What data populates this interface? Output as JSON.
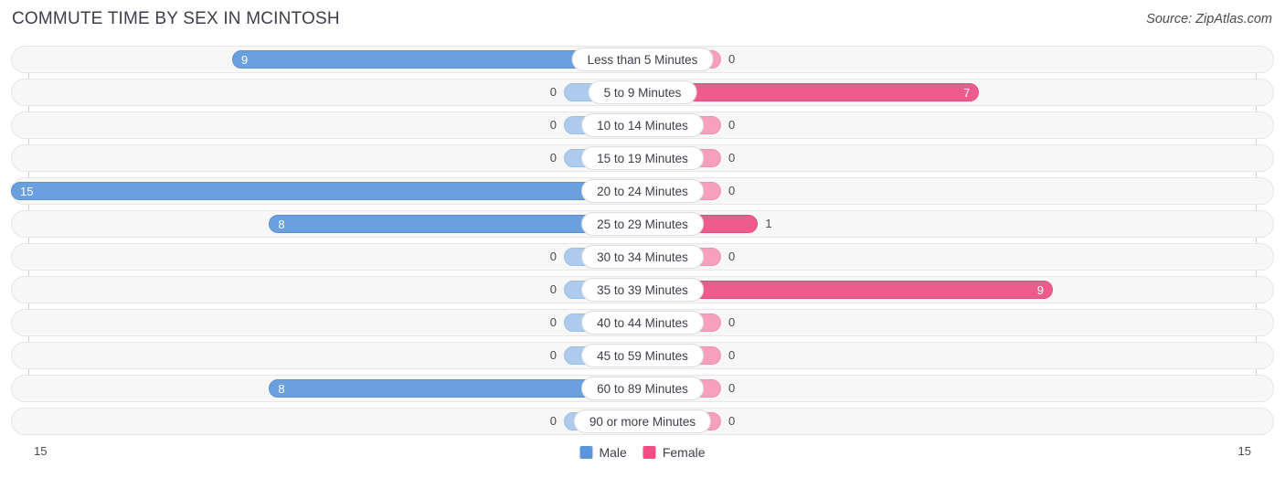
{
  "header": {
    "title": "COMMUTE TIME BY SEX IN MCINTOSH",
    "source": "Source: ZipAtlas.com"
  },
  "legend": {
    "male_label": "Male",
    "female_label": "Female",
    "male_color": "#5b95dd",
    "female_color": "#ef4f84"
  },
  "axis": {
    "left_label": "15",
    "right_label": "15",
    "max": 15
  },
  "chart_data": {
    "type": "bar",
    "title": "COMMUTE TIME BY SEX IN MCINTOSH",
    "subtitle": "Source: ZipAtlas.com",
    "orientation": "horizontal-diverging",
    "xlabel": "",
    "ylabel": "",
    "xlim": [
      15,
      15
    ],
    "grid": false,
    "legend_position": "bottom-center",
    "categories": [
      "Less than 5 Minutes",
      "5 to 9 Minutes",
      "10 to 14 Minutes",
      "15 to 19 Minutes",
      "20 to 24 Minutes",
      "25 to 29 Minutes",
      "30 to 34 Minutes",
      "35 to 39 Minutes",
      "40 to 44 Minutes",
      "45 to 59 Minutes",
      "60 to 89 Minutes",
      "90 or more Minutes"
    ],
    "series": [
      {
        "name": "Male",
        "color": "#5b95dd",
        "values": [
          9,
          0,
          0,
          0,
          15,
          8,
          0,
          0,
          0,
          0,
          8,
          0
        ]
      },
      {
        "name": "Female",
        "color": "#ef4f84",
        "values": [
          0,
          7,
          0,
          0,
          0,
          1,
          0,
          9,
          0,
          0,
          0,
          0
        ]
      }
    ]
  },
  "rows": [
    {
      "label": "Less than 5 Minutes",
      "male": 9,
      "male_text": "9",
      "female": 0,
      "female_text": "0"
    },
    {
      "label": "5 to 9 Minutes",
      "male": 0,
      "male_text": "0",
      "female": 7,
      "female_text": "7"
    },
    {
      "label": "10 to 14 Minutes",
      "male": 0,
      "male_text": "0",
      "female": 0,
      "female_text": "0"
    },
    {
      "label": "15 to 19 Minutes",
      "male": 0,
      "male_text": "0",
      "female": 0,
      "female_text": "0"
    },
    {
      "label": "20 to 24 Minutes",
      "male": 15,
      "male_text": "15",
      "female": 0,
      "female_text": "0"
    },
    {
      "label": "25 to 29 Minutes",
      "male": 8,
      "male_text": "8",
      "female": 1,
      "female_text": "1"
    },
    {
      "label": "30 to 34 Minutes",
      "male": 0,
      "male_text": "0",
      "female": 0,
      "female_text": "0"
    },
    {
      "label": "35 to 39 Minutes",
      "male": 0,
      "male_text": "0",
      "female": 9,
      "female_text": "9"
    },
    {
      "label": "40 to 44 Minutes",
      "male": 0,
      "male_text": "0",
      "female": 0,
      "female_text": "0"
    },
    {
      "label": "45 to 59 Minutes",
      "male": 0,
      "male_text": "0",
      "female": 0,
      "female_text": "0"
    },
    {
      "label": "60 to 89 Minutes",
      "male": 8,
      "male_text": "8",
      "female": 0,
      "female_text": "0"
    },
    {
      "label": "90 or more Minutes",
      "male": 0,
      "male_text": "0",
      "female": 0,
      "female_text": "0"
    }
  ]
}
